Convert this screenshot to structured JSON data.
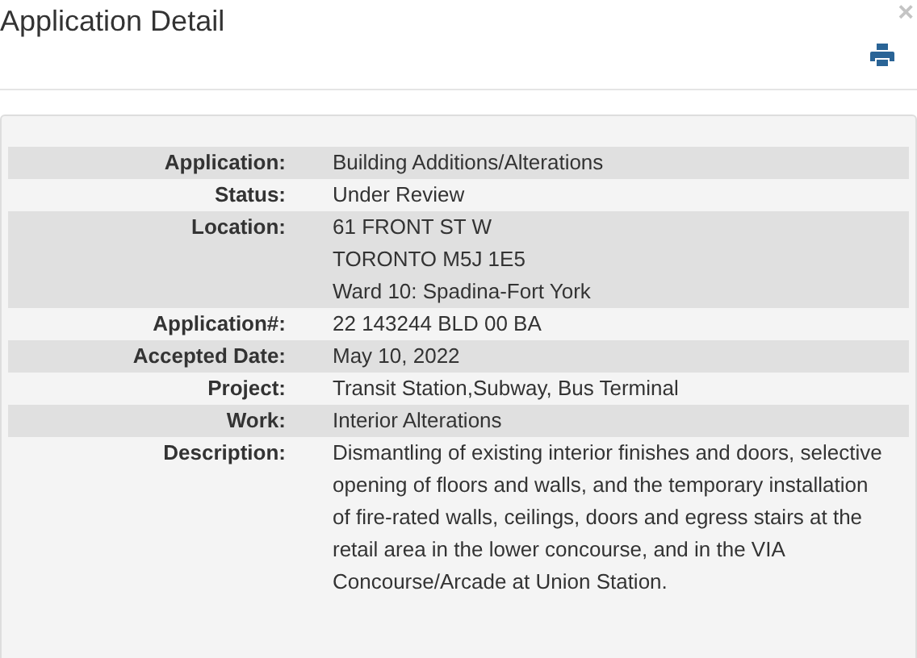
{
  "dialog": {
    "title": "Application Detail",
    "close": "×"
  },
  "details": [
    {
      "label": "Application:",
      "lines": [
        "Building Additions/Alterations"
      ]
    },
    {
      "label": "Status:",
      "lines": [
        "Under Review"
      ]
    },
    {
      "label": "Location:",
      "lines": [
        "61 FRONT ST W",
        "TORONTO M5J 1E5",
        "Ward 10: Spadina-Fort York"
      ]
    },
    {
      "label": "Application#:",
      "lines": [
        "22 143244 BLD 00 BA"
      ]
    },
    {
      "label": "Accepted Date:",
      "lines": [
        "May 10, 2022"
      ]
    },
    {
      "label": "Project:",
      "lines": [
        "Transit Station,Subway, Bus Terminal"
      ]
    },
    {
      "label": "Work:",
      "lines": [
        "Interior Alterations"
      ]
    },
    {
      "label": "Description:",
      "lines": [
        "Dismantling of existing interior finishes and doors, selective opening of floors and walls, and the temporary installation of fire-rated walls, ceilings, doors and egress stairs at the retail area in the lower concourse, and in the VIA Concourse/Arcade at Union Station."
      ]
    }
  ]
}
